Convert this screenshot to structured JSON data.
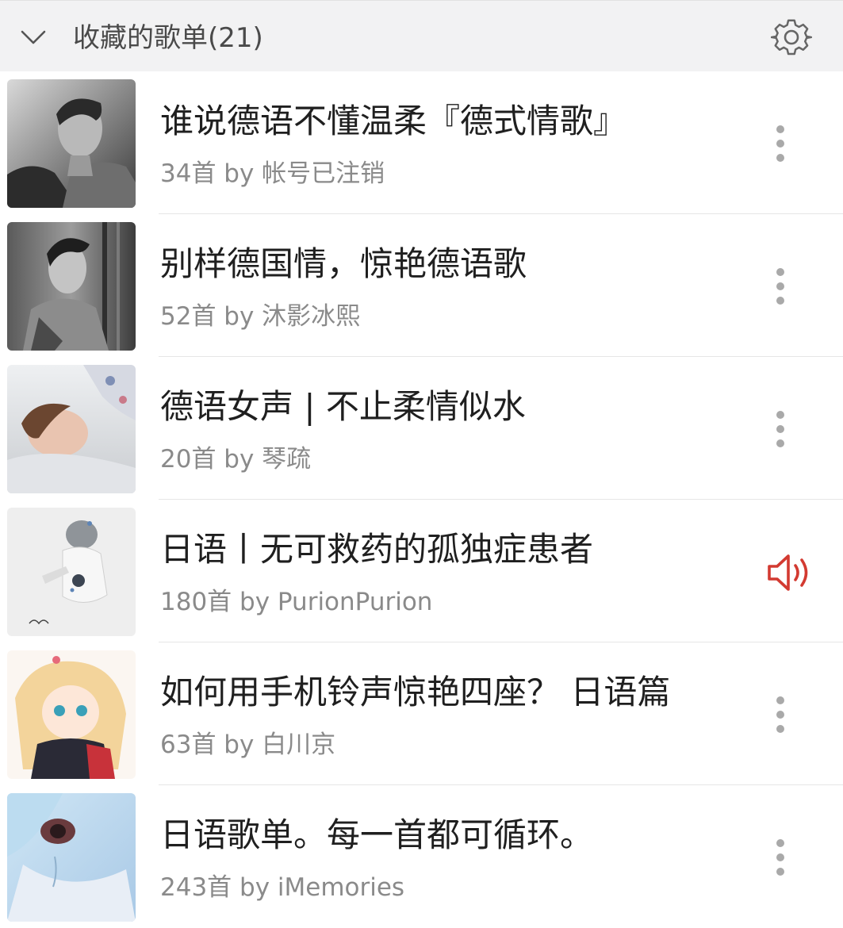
{
  "header": {
    "title": "收藏的歌单(21)",
    "chevron_icon": "chevron-down-icon",
    "settings_icon": "gear-icon"
  },
  "playlists": [
    {
      "name": "谁说德语不懂温柔『德式情歌』",
      "meta": "34首 by 帐号已注销",
      "action_icon": "more-vertical-icon"
    },
    {
      "name": "别样德国情，惊艳德语歌",
      "meta": "52首 by 沐影冰熙",
      "action_icon": "more-vertical-icon"
    },
    {
      "name": "德语女声 | 不止柔情似水",
      "meta": "20首 by 琴疏",
      "action_icon": "more-vertical-icon"
    },
    {
      "name": "日语丨无可救药的孤独症患者",
      "meta": "180首 by PurionPurion",
      "action_icon": "speaker-playing-icon"
    },
    {
      "name": "如何用手机铃声惊艳四座？ 日语篇",
      "meta": "63首 by 白川京",
      "action_icon": "more-vertical-icon"
    },
    {
      "name": "日语歌单。每一首都可循环。",
      "meta": "243首 by iMemories",
      "action_icon": "more-vertical-icon"
    }
  ],
  "colors": {
    "header_bg": "#f2f2f3",
    "title_text": "#1f1f1f",
    "meta_text": "#8a8a8a",
    "playing_accent": "#d33a31",
    "more_dots": "#a9a9a9"
  }
}
